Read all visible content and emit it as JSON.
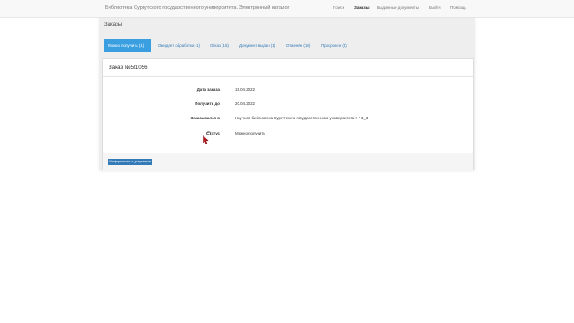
{
  "app": {
    "title": "Библиотека Сургутского государственного университета. Электронный каталог"
  },
  "nav": {
    "items": [
      "Поиск",
      "Заказы",
      "Выданные документы",
      "Выйти",
      "Помощь"
    ],
    "active": "Заказы"
  },
  "page": {
    "title": "Заказы"
  },
  "tabs": [
    "Можно получить (1)",
    "Ожидает обработки (1)",
    "Отказ (16)",
    "Документ выдан (1)",
    "Отменён (18)",
    "Просрочен (4)"
  ],
  "active_tab": "Можно получить (1)",
  "order": {
    "title": "Заказ №5f1056",
    "fields": [
      {
        "label": "Дата заказа",
        "value": "15.04.2022"
      },
      {
        "label": "Получить до",
        "value": "20.04.2022"
      },
      {
        "label": "Заказывался в",
        "value": "Научная библиотека Сургутского государственного университета > Ч3_3"
      },
      {
        "label": "Статус",
        "value": "Можно получить"
      }
    ],
    "button_label": "Информация о документе"
  },
  "colors": {
    "accent": "#3a9fe0",
    "button": "#337ab7",
    "link": "#337ab7",
    "cursor": "#c0171f"
  },
  "icons": {
    "cursor": "mouse-pointer-icon",
    "radio": "radio-button"
  }
}
